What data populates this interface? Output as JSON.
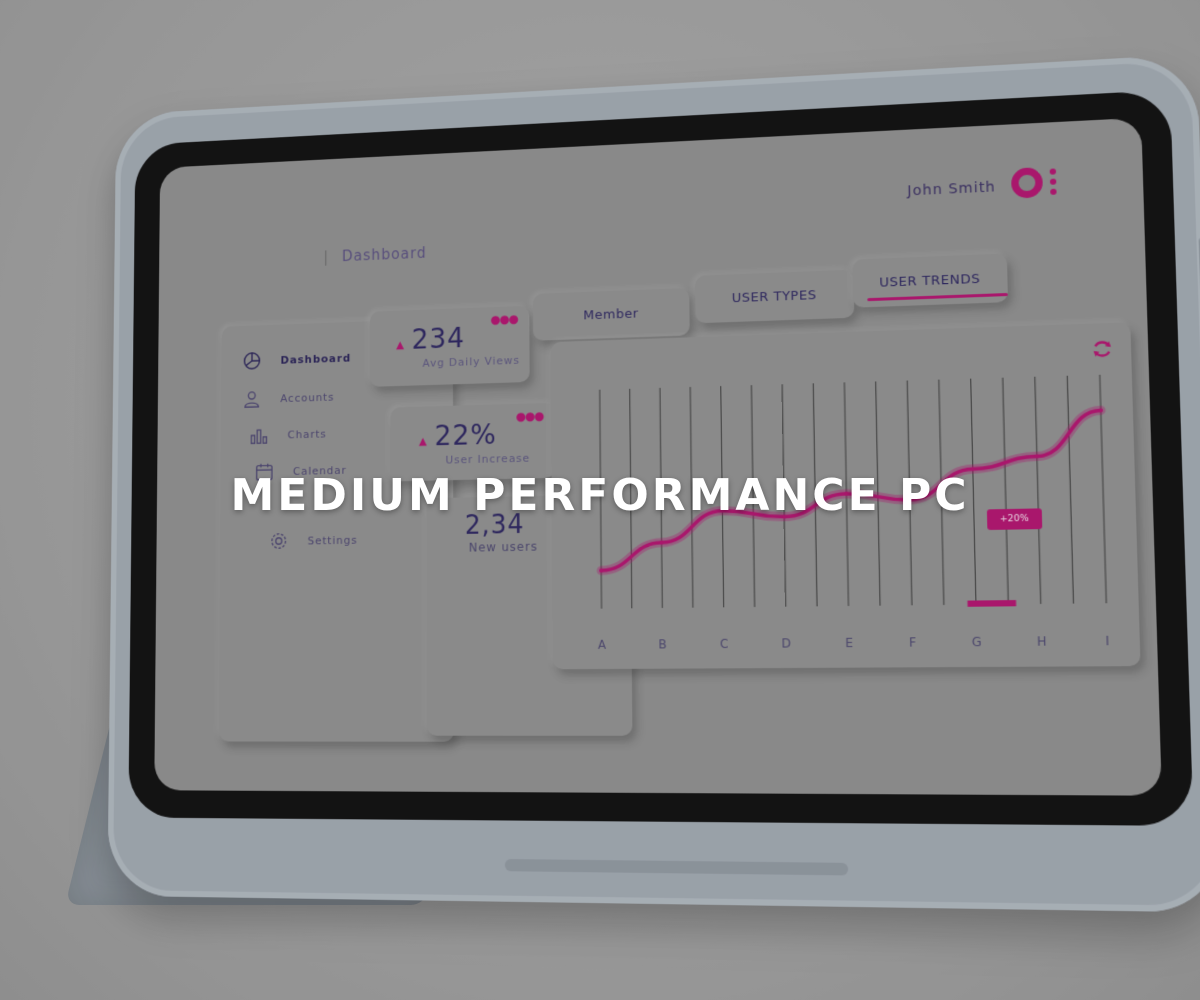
{
  "header": {
    "user_name": "John Smith",
    "breadcrumb": "Dashboard"
  },
  "sidebar": {
    "items": [
      {
        "label": "Dashboard",
        "icon": "pie-chart-icon",
        "active": true
      },
      {
        "label": "Accounts",
        "icon": "user-icon",
        "active": false
      },
      {
        "label": "Charts",
        "icon": "bar-chart-icon",
        "active": false
      },
      {
        "label": "Calendar",
        "icon": "calendar-icon",
        "active": false
      },
      {
        "label": "Settings",
        "icon": "gear-icon",
        "active": false
      }
    ]
  },
  "stats": [
    {
      "value": "234",
      "label": "Avg Daily Views",
      "trend": "up"
    },
    {
      "value": "22%",
      "label": "User Increase",
      "trend": "up"
    },
    {
      "value": "2,34",
      "label": "New users"
    }
  ],
  "tabs": [
    {
      "label": "Member",
      "active": false
    },
    {
      "label": "USER TYPES",
      "active": false
    },
    {
      "label": "USER TRENDS",
      "active": true
    }
  ],
  "chart": {
    "badge": "+20%",
    "categories": [
      "A",
      "B",
      "C",
      "D",
      "E",
      "F",
      "G",
      "H",
      "I"
    ],
    "highlighted_category": "G"
  },
  "chart_data": {
    "type": "line",
    "categories": [
      "A",
      "B",
      "C",
      "D",
      "E",
      "F",
      "G",
      "H",
      "I"
    ],
    "series": [
      {
        "values": [
          0.1,
          0.25,
          0.42,
          0.38,
          0.5,
          0.46,
          0.62,
          0.68,
          0.92
        ]
      }
    ],
    "annotations": [
      "+20%"
    ],
    "grid": true,
    "line_color": "#b0156f"
  },
  "overlay": {
    "headline": "MEDIUM PERFORMANCE PC"
  },
  "colors": {
    "accent": "#b0156f",
    "text": "#2d2660",
    "panel": "#8f8f8f"
  }
}
